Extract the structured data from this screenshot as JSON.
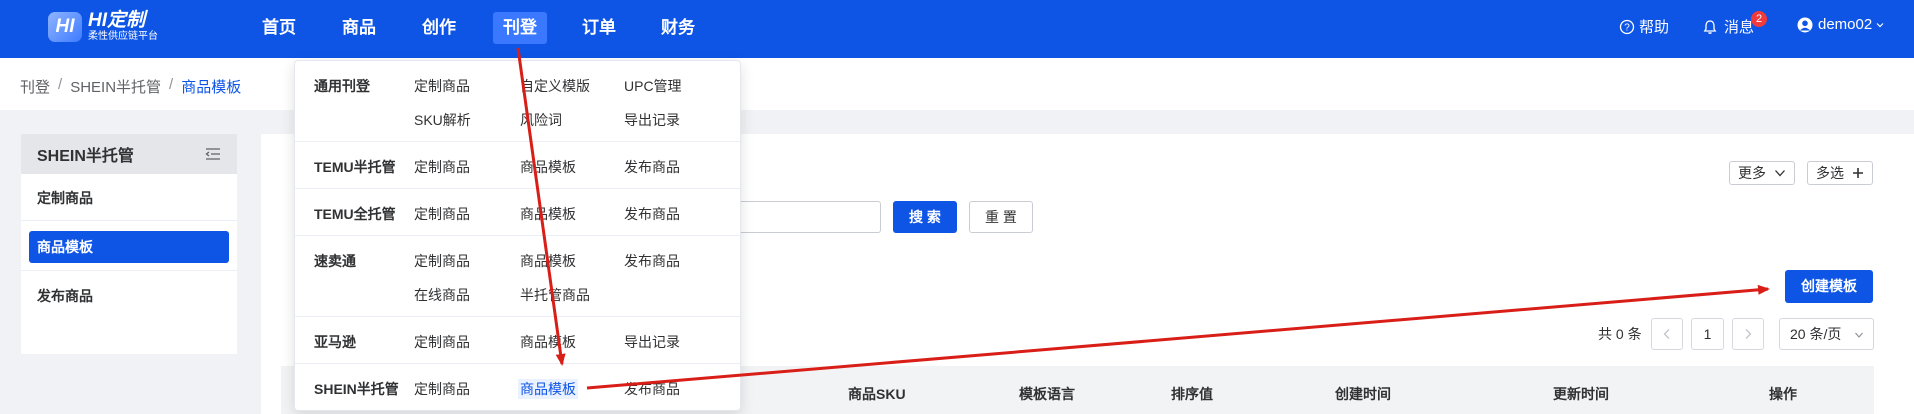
{
  "brand": {
    "logo_mark": "HI",
    "title": "HI定制",
    "subtitle": "柔性供应链平台"
  },
  "nav": {
    "items": [
      "首页",
      "商品",
      "创作",
      "刊登",
      "订单",
      "财务"
    ],
    "active": "刊登"
  },
  "header_right": {
    "help": "帮助",
    "messages": "消息",
    "message_count": "2",
    "user": "demo02"
  },
  "breadcrumb": [
    "刊登",
    "SHEIN半托管",
    "商品模板"
  ],
  "sidebar": {
    "title": "SHEIN半托管",
    "items": [
      "定制商品",
      "商品模板",
      "发布商品"
    ],
    "active": "商品模板"
  },
  "toolbar": {
    "more": "更多",
    "multi": "多选",
    "search": "搜 索",
    "reset": "重 置",
    "create": "创建模板"
  },
  "pagination": {
    "total": "共 0 条",
    "current_page": "1",
    "page_size": "20 条/页"
  },
  "table": {
    "columns": [
      "商品SKU",
      "模板语言",
      "排序值",
      "创建时间",
      "更新时间",
      "操作"
    ]
  },
  "dropdown": {
    "groups": [
      {
        "name": "通用刊登",
        "links": [
          "定制商品",
          "自定义模版",
          "UPC管理",
          "SKU解析",
          "风险词",
          "导出记录"
        ]
      },
      {
        "name": "TEMU半托管",
        "links": [
          "定制商品",
          "商品模板",
          "发布商品"
        ]
      },
      {
        "name": "TEMU全托管",
        "links": [
          "定制商品",
          "商品模板",
          "发布商品"
        ]
      },
      {
        "name": "速卖通",
        "links": [
          "定制商品",
          "商品模板",
          "发布商品",
          "在线商品",
          "半托管商品"
        ]
      },
      {
        "name": "亚马逊",
        "links": [
          "定制商品",
          "商品模板",
          "导出记录"
        ]
      },
      {
        "name": "SHEIN半托管",
        "links": [
          "定制商品",
          "商品模板",
          "发布商品"
        ]
      }
    ],
    "active_group": "SHEIN半托管",
    "active_link": "商品模板"
  },
  "icons": {
    "help": "help-circle-icon",
    "bell": "bell-icon",
    "user": "user-avatar-icon",
    "collapse": "menu-collapse-icon",
    "chevron_down": "chevron-down-icon",
    "plus": "plus-icon",
    "prev": "chevron-left-icon",
    "next": "chevron-right-icon"
  },
  "colors": {
    "primary": "#0e55e6",
    "badge": "#f2393c",
    "annotation_arrow": "#d91e18"
  }
}
